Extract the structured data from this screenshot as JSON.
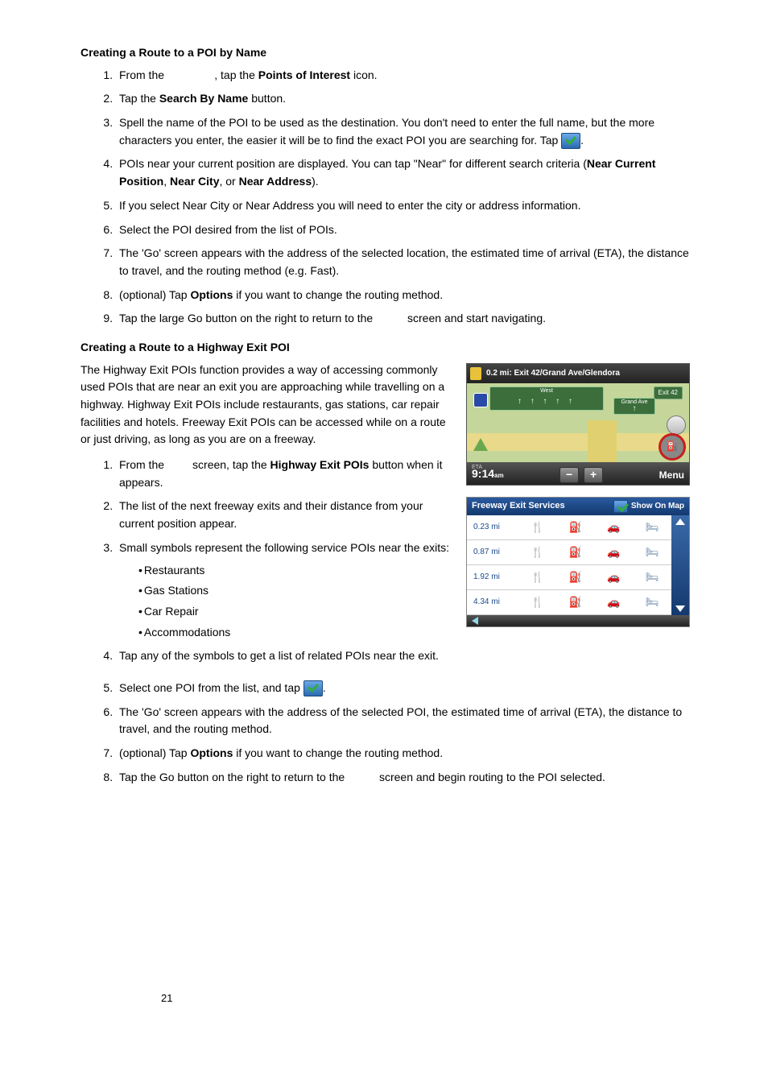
{
  "section1": {
    "heading": "Creating a Route to a POI by Name",
    "steps": {
      "s1": {
        "pre": "From the ",
        "gap": "               ",
        "post1": ", tap the ",
        "bold": "Points of Interest",
        "post2": " icon."
      },
      "s2": {
        "pre": "Tap the ",
        "bold": "Search By Name",
        "post": " button."
      },
      "s3": {
        "text1": "Spell the name of the POI to be used as the destination. You don't need to enter the full name, but the more characters you enter, the easier it will be to find the exact POI you are searching for.  Tap  ",
        "text2": "."
      },
      "s4": {
        "pre": "POIs near your current position are displayed.  You can tap \"Near\" for different search criteria (",
        "b1": "Near Current Position",
        "c1": ", ",
        "b2": "Near City",
        "c2": ", or ",
        "b3": "Near Address",
        "post": ")."
      },
      "s5": "If you select Near City or Near Address you will need to enter the city or address information.",
      "s6": "Select the POI desired from the list of POIs.",
      "s7": "The 'Go' screen appears with the address of the selected location, the estimated time of arrival (ETA), the distance to travel, and the routing method (e.g. Fast).",
      "s8": {
        "pre": "(optional) Tap ",
        "bold": "Options",
        "post": " if you want to change the routing method."
      },
      "s9": {
        "pre": "Tap the large Go button on the right to return to the ",
        "gap": "          ",
        "post": "screen and start navigating."
      }
    }
  },
  "section2": {
    "heading": "Creating a Route to a Highway Exit POI",
    "intro": "The Highway Exit POIs function provides a way of accessing commonly used POIs that are near an exit you are approaching while travelling on a highway. Highway Exit POIs include restaurants, gas stations, car repair facilities and hotels. Freeway Exit POIs can be accessed while on a route or just driving, as long as you are on a freeway.",
    "steps": {
      "s1": {
        "pre": "From the ",
        "gap": "        ",
        "mid": "screen, tap the ",
        "bold": "Highway Exit POIs",
        "post": " button when it appears."
      },
      "s2": "The list of the next freeway exits and their distance from your current position appear.",
      "s3": "Small symbols represent the following service POIs near the exits:",
      "bullets": [
        "Restaurants",
        "Gas Stations",
        "Car Repair",
        "Accommodations"
      ],
      "s4": "Tap any of the symbols to get a list of related POIs near the exit.",
      "s5": {
        "pre": "Select one POI from the list, and tap  ",
        "post": "."
      },
      "s6": "The 'Go' screen appears with the address of the selected POI, the estimated time of arrival (ETA), the distance to travel, and the routing method.",
      "s7": {
        "pre": "(optional) Tap ",
        "bold": "Options",
        "post": " if you want to change the routing method."
      },
      "s8": {
        "pre": "Tap the Go button on the right to return to the ",
        "gap": "          ",
        "post": "screen and begin routing to the POI selected."
      }
    }
  },
  "map": {
    "distance": "0.2 mi:",
    "exit_title": "Exit 42/Grand Ave/Glendora",
    "exit_tag": "Exit 42",
    "grand": "Grand Ave",
    "eta_label": "ETA",
    "time": "9:14",
    "ampm": "am",
    "menu": "Menu"
  },
  "exit_services": {
    "title": "Freeway Exit Services",
    "show_on_map": "Show On Map",
    "rows": [
      "0.23 mi",
      "0.87 mi",
      "1.92 mi",
      "4.34 mi"
    ]
  },
  "page_number": "21"
}
